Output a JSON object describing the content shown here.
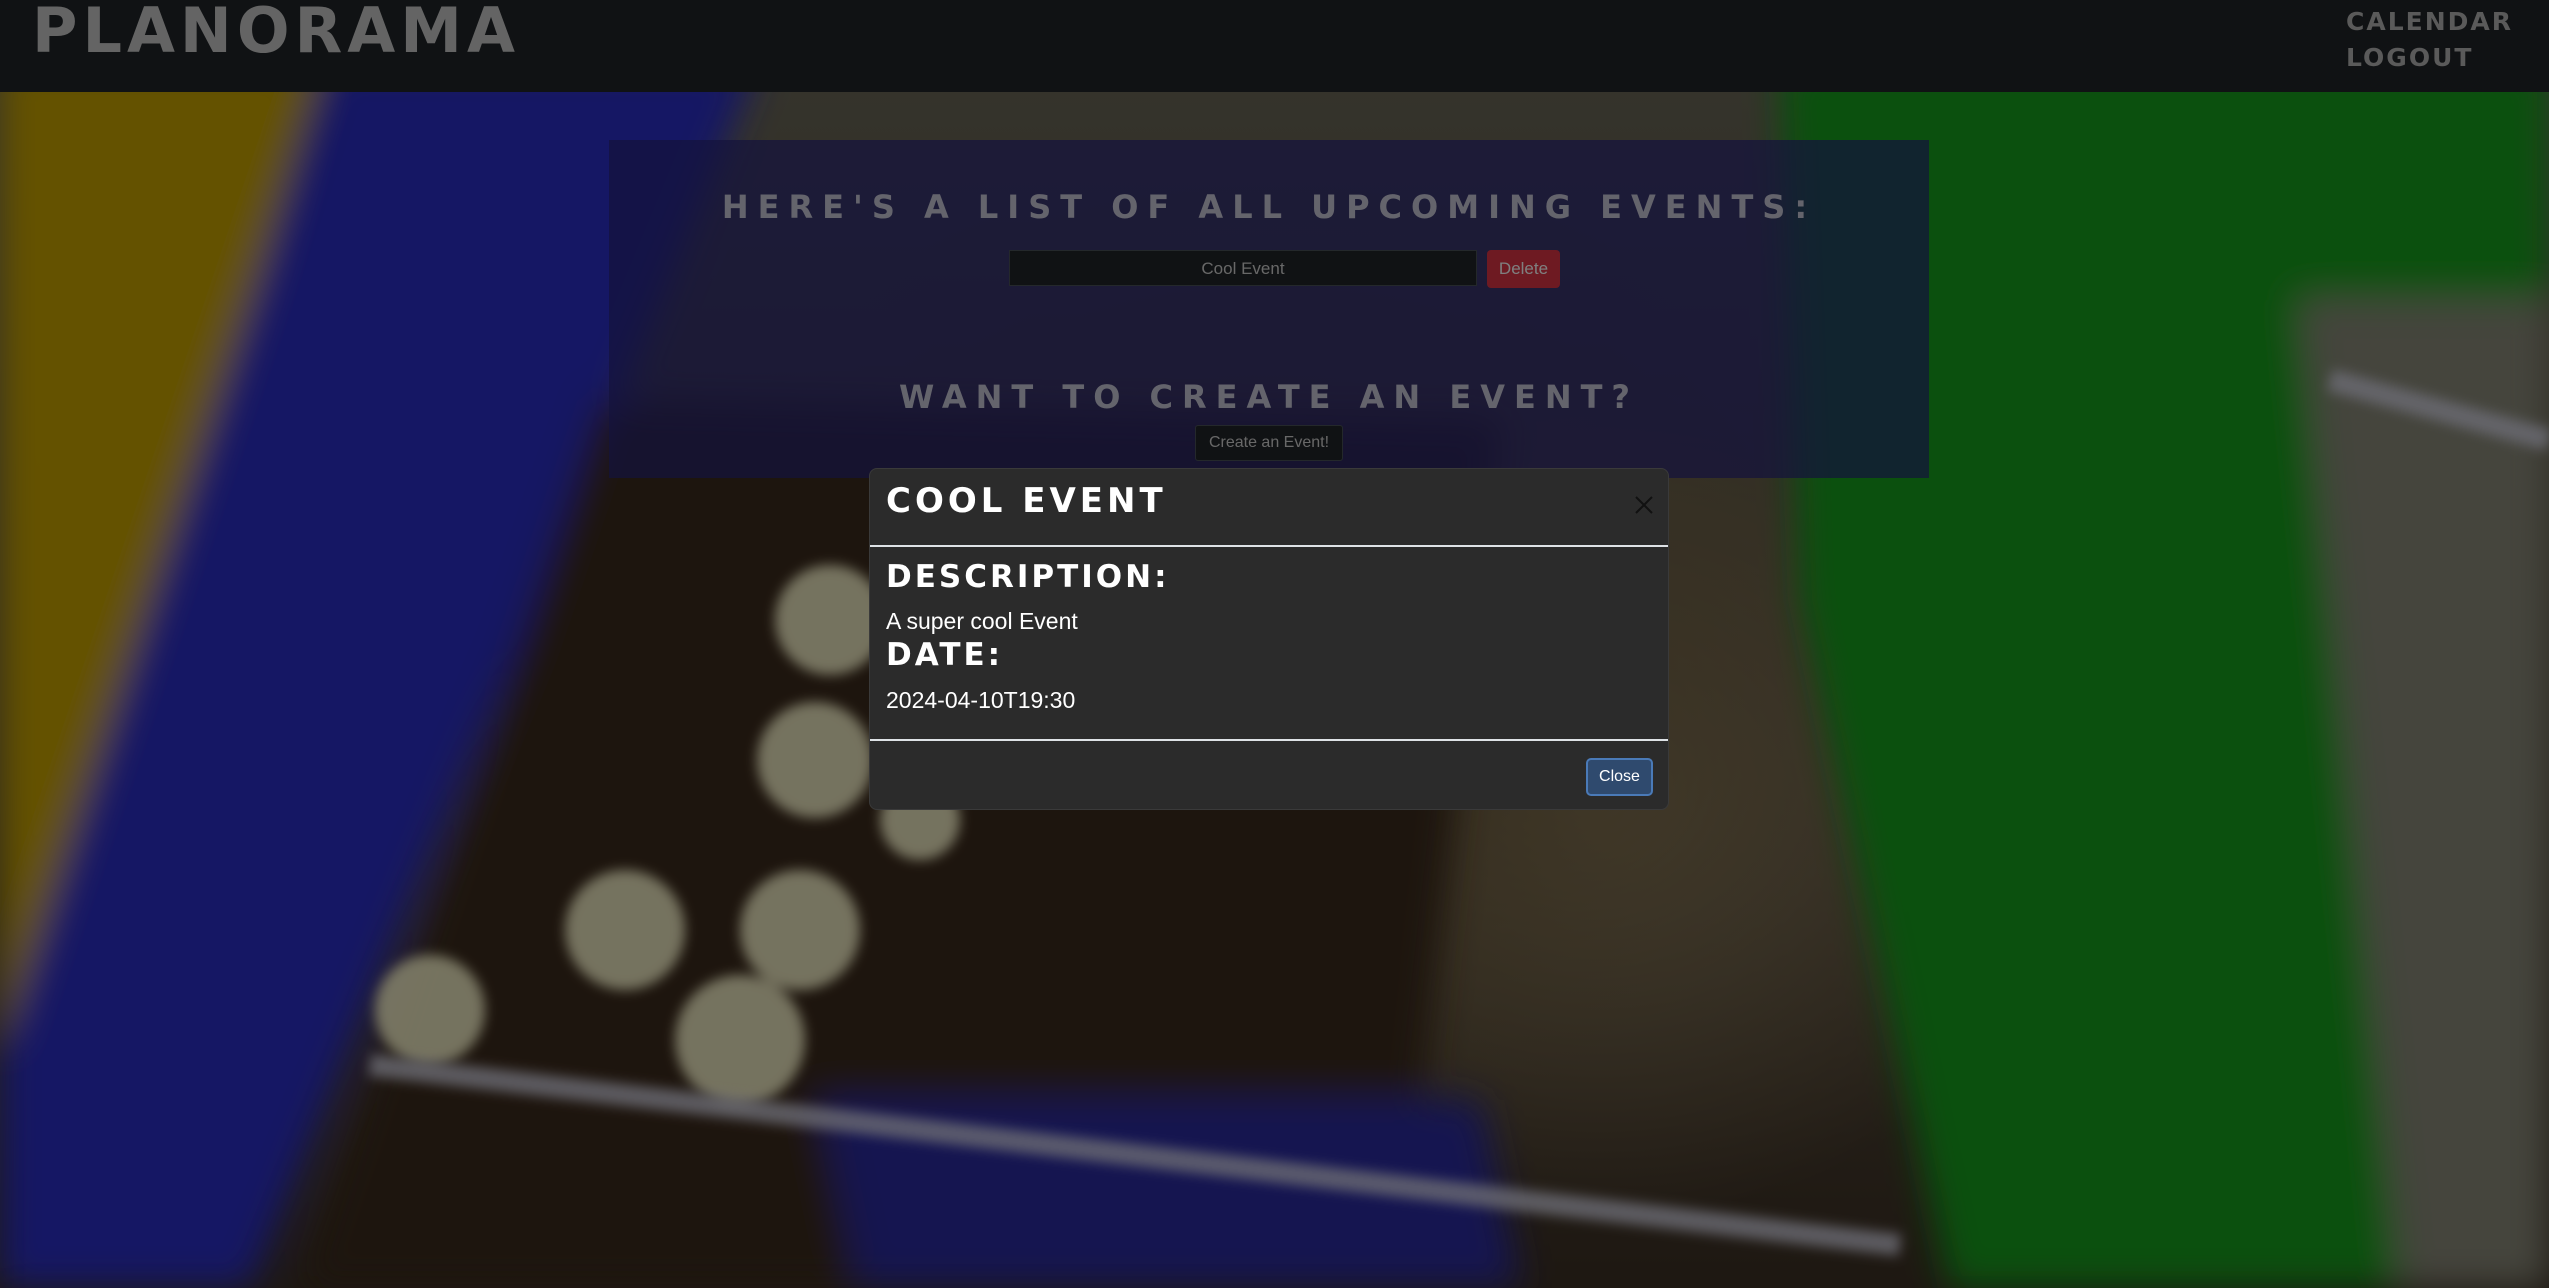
{
  "navbar": {
    "brand": "PLANORAMA",
    "links": [
      {
        "label": "CALENDAR"
      },
      {
        "label": "LOGOUT"
      }
    ]
  },
  "events_panel": {
    "list_heading": "HERE'S A LIST OF ALL UPCOMING EVENTS:",
    "events": [
      {
        "title": "Cool Event",
        "delete_label": "Delete"
      }
    ],
    "create_heading": "WANT TO CREATE AN EVENT?",
    "create_button": "Create an Event!"
  },
  "modal": {
    "title": "COOL EVENT",
    "close_icon": "close-icon",
    "description_label": "DESCRIPTION:",
    "description_value": "A super cool Event",
    "date_label": "DATE:",
    "date_value": "2024-04-10T19:30",
    "close_button": "Close"
  },
  "colors": {
    "navbar_bg": "#212529",
    "panel_bg": "#28267a",
    "danger": "#dc3545",
    "modal_bg": "#2b2b2b",
    "primary_border": "#4a7ab8"
  }
}
